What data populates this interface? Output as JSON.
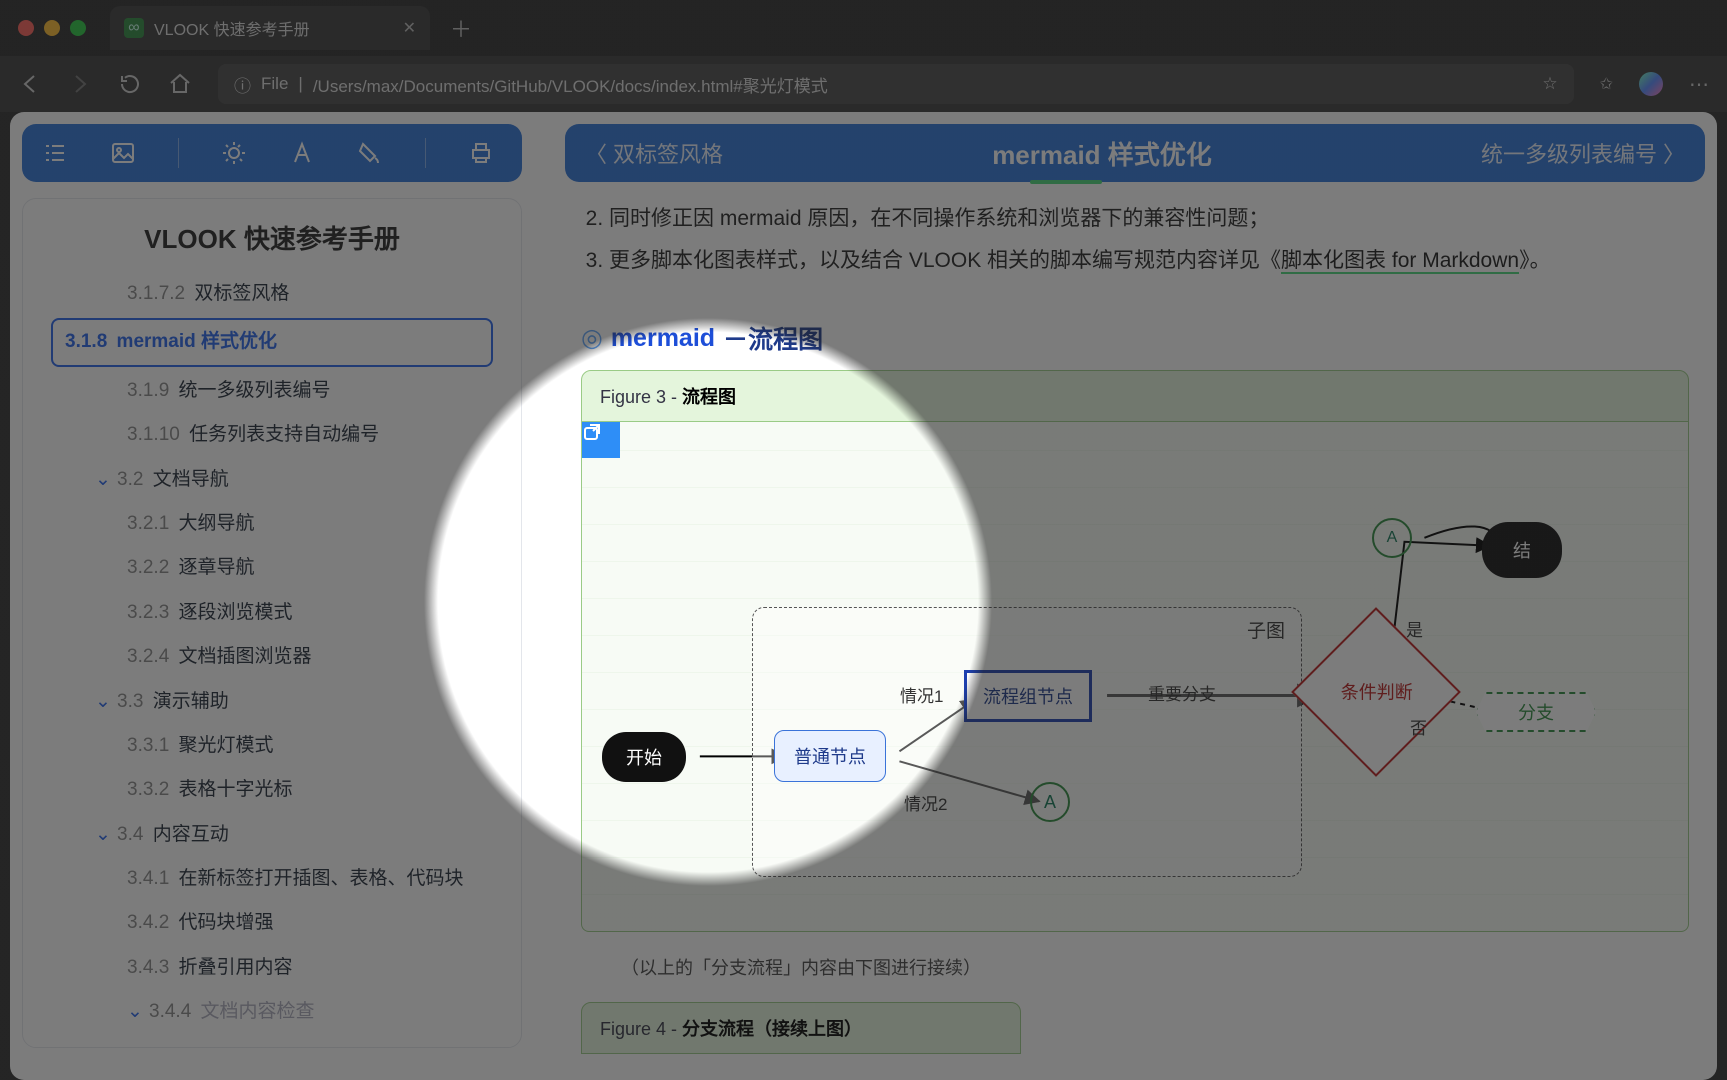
{
  "browser": {
    "tab_title": "VLOOK 快速参考手册",
    "url_prefix": "File",
    "url": "/Users/max/Documents/GitHub/VLOOK/docs/index.html#聚光灯模式"
  },
  "ribbon": {
    "prev": "双标签风格",
    "title": "mermaid 样式优化",
    "next": "统一多级列表编号"
  },
  "sidebar": {
    "title": "VLOOK 快速参考手册",
    "items": [
      {
        "num": "3.1.7.2",
        "label": "双标签风格",
        "lvl": "l3"
      },
      {
        "num": "3.1.8",
        "label": "mermaid 样式优化",
        "lvl": "l2",
        "active": true
      },
      {
        "num": "3.1.9",
        "label": "统一多级列表编号",
        "lvl": "l3"
      },
      {
        "num": "3.1.10",
        "label": "任务列表支持自动编号",
        "lvl": "l3"
      },
      {
        "num": "3.2",
        "label": "文档导航",
        "lvl": "l2",
        "caret": true
      },
      {
        "num": "3.2.1",
        "label": "大纲导航",
        "lvl": "l3"
      },
      {
        "num": "3.2.2",
        "label": "逐章导航",
        "lvl": "l3"
      },
      {
        "num": "3.2.3",
        "label": "逐段浏览模式",
        "lvl": "l3"
      },
      {
        "num": "3.2.4",
        "label": "文档插图浏览器",
        "lvl": "l3"
      },
      {
        "num": "3.3",
        "label": "演示辅助",
        "lvl": "l2",
        "caret": true
      },
      {
        "num": "3.3.1",
        "label": "聚光灯模式",
        "lvl": "l3"
      },
      {
        "num": "3.3.2",
        "label": "表格十字光标",
        "lvl": "l3"
      },
      {
        "num": "3.4",
        "label": "内容互动",
        "lvl": "l2",
        "caret": true
      },
      {
        "num": "3.4.1",
        "label": "在新标签打开插图、表格、代码块",
        "lvl": "l3"
      },
      {
        "num": "3.4.2",
        "label": "代码块增强",
        "lvl": "l3"
      },
      {
        "num": "3.4.3",
        "label": "折叠引用内容",
        "lvl": "l3"
      },
      {
        "num": "3.4.4",
        "label": "文档内容检查",
        "lvl": "l3",
        "muted": true,
        "caret": true
      }
    ]
  },
  "main": {
    "li2": "同时修正因 mermaid 原因，在不同操作系统和浏览器下的兼容性问题；",
    "li3_a": "更多脚本化图表样式，以及结合 VLOOK 相关的脚本编写规范内容详见《",
    "li3_link": "脚本化图表 for Markdown",
    "li3_b": "》。",
    "section_chip": "◎",
    "section_a": "mermaid",
    "section_dash": "－",
    "section_b": "流程图",
    "fig3_cap_a": "Figure 3 - ",
    "fig3_cap_b": "流程图",
    "note": "（以上的「分支流程」内容由下图进行接续）",
    "fig4_cap_a": "Figure 4 - ",
    "fig4_cap_b": "分支流程（接续上图）"
  },
  "diagram": {
    "sub_title": "子图",
    "start": "开始",
    "normal": "普通节点",
    "proc": "流程组节点",
    "a": "A",
    "cond": "条件判断",
    "end": "结",
    "branch": "分支",
    "e1": "情况1",
    "e2": "情况2",
    "e3": "重要分支",
    "e4": "是",
    "e5": "否"
  }
}
